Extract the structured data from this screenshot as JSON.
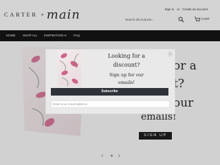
{
  "header": {
    "logo_caps": "CARTER +",
    "logo_script": "main",
    "login_label": "Sign in",
    "separator": "or",
    "create_account_label": "Create an account",
    "search_placeholder": "Search all products...",
    "cart_label": "CART"
  },
  "nav": {
    "items": [
      {
        "label": "HOME"
      },
      {
        "label": "SHOP ALL"
      },
      {
        "label": "INSPIRATION"
      },
      {
        "label": "FAQ"
      }
    ]
  },
  "hero": {
    "line1": "or a",
    "line2": "t?",
    "line3": "our",
    "line4": "emails!",
    "signup_label": "SIGN UP"
  },
  "modal": {
    "title_line1": "Looking for a",
    "title_line2": "discount?",
    "sub_line1": "Sign up for our",
    "sub_line2": "emails!",
    "subscribe_label": "Subscribe",
    "email_placeholder": "Enter your email address"
  }
}
